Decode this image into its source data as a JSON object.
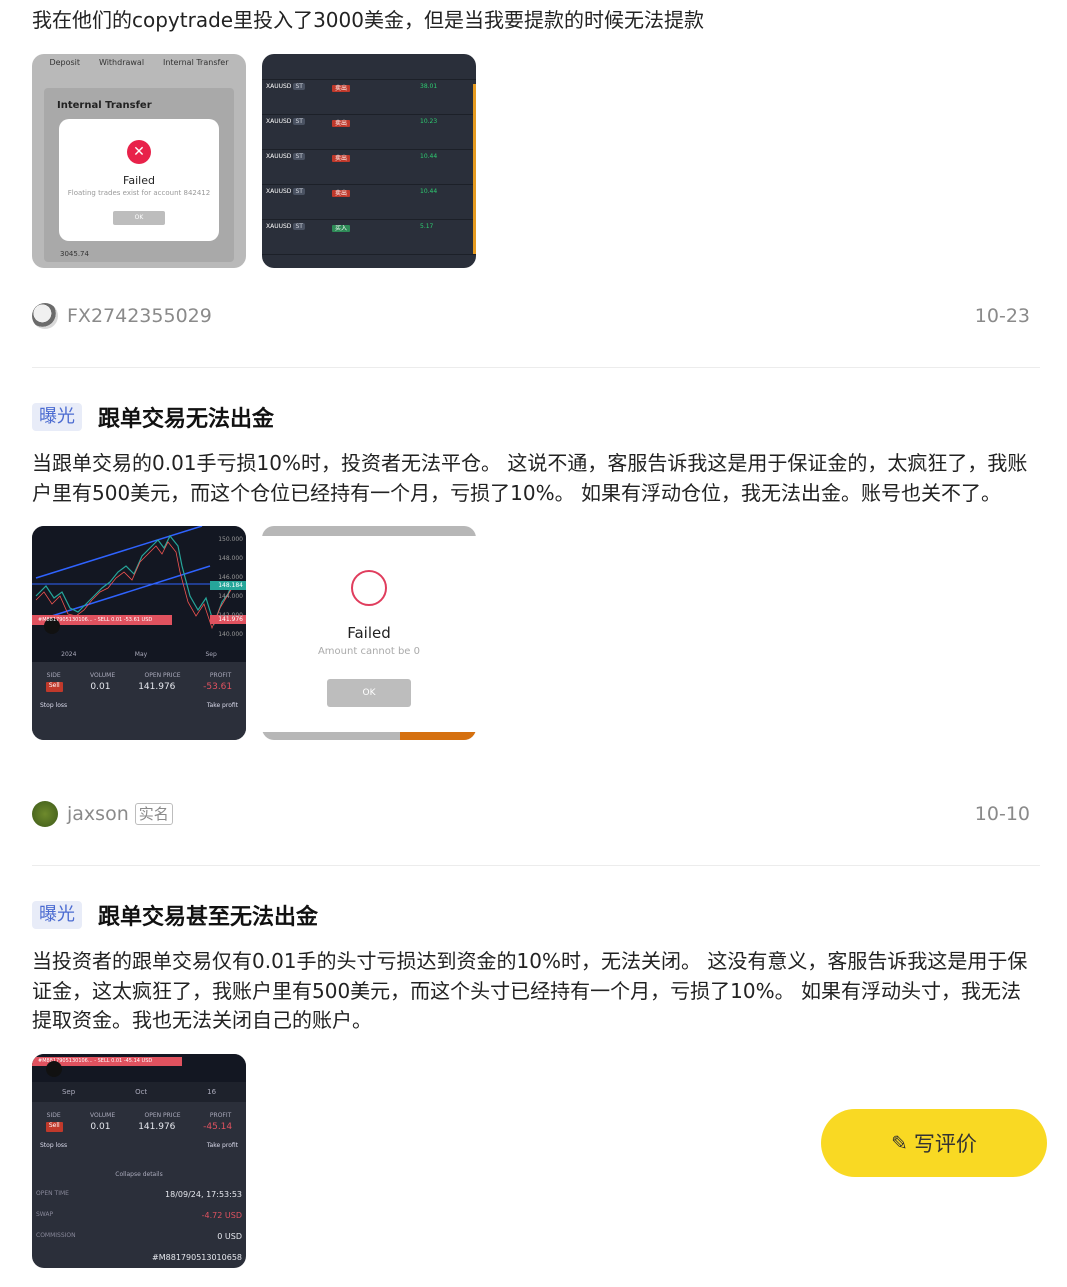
{
  "posts": [
    {
      "text": "我在他们的copytrade里投入了3000美金，但是当我要提款的时候无法提款",
      "author": "FX2742355029",
      "date": "10-23",
      "images": [
        {
          "tabs": [
            "Deposit",
            "Withdrawal",
            "Internal Transfer"
          ],
          "panel_title": "Internal Transfer",
          "amount": "3045.74",
          "dialog_title": "Failed",
          "dialog_message": "Floating trades exist for account 842412",
          "ok_label": "OK"
        },
        {
          "rows": [
            {
              "symbol": "XAUUSD",
              "badge": "ST",
              "side": "卖出",
              "value": "38.01"
            },
            {
              "symbol": "XAUUSD",
              "badge": "ST",
              "side": "卖出",
              "value": "10.23"
            },
            {
              "symbol": "XAUUSD",
              "badge": "ST",
              "side": "卖出",
              "value": "10.44"
            },
            {
              "symbol": "XAUUSD",
              "badge": "ST",
              "side": "卖出",
              "value": "10.44"
            },
            {
              "symbol": "XAUUSD",
              "badge": "ST",
              "side": "买入",
              "value": "5.17"
            }
          ]
        }
      ]
    },
    {
      "tag": "曝光",
      "title": "跟单交易无法出金",
      "text": "当跟单交易的0.01手亏损10%时，投资者无法平仓。 这说不通，客服告诉我这是用于保证金的，太疯狂了，我账户里有500美元，而这个仓位已经持有一个月，亏损了10%。 如果有浮动仓位，我无法出金。账号也关不了。",
      "author": "jaxson",
      "verified_label": "实名",
      "date": "10-10",
      "images": [
        {
          "price_labels": [
            "150.000",
            "148.000",
            "146.000",
            "144.000",
            "142.000",
            "140.000"
          ],
          "current_price": "148.184",
          "order_price": "141.976",
          "order_banner": "#M8817905130106... - SELL 0.01   -53.61 USD",
          "time_labels": [
            "2024",
            "May",
            "Sep"
          ],
          "headers": [
            "SIDE",
            "VOLUME",
            "OPEN PRICE",
            "PROFIT"
          ],
          "side": "Sell",
          "volume": "0.01",
          "open_price": "141.976",
          "profit": "-53.61",
          "stop_loss": "Stop loss",
          "take_profit": "Take profit"
        },
        {
          "dialog_title": "Failed",
          "dialog_message": "Amount cannot be 0",
          "ok_label": "OK"
        }
      ]
    },
    {
      "tag": "曝光",
      "title": "跟单交易甚至无法出金",
      "text": "当投资者的跟单交易仅有0.01手的头寸亏损达到资金的10%时，无法关闭。 这没有意义，客服告诉我这是用于保证金，这太疯狂了，我账户里有500美元，而这个头寸已经持有一个月，亏损了10%。 如果有浮动头寸，我无法提取资金。我也无法关闭自己的账户。",
      "images": [
        {
          "order_banner": "#M8817905130106... - SELL 0.01   -45.14 USD",
          "time_labels": [
            "Sep",
            "Oct",
            "16"
          ],
          "headers": [
            "SIDE",
            "VOLUME",
            "OPEN PRICE",
            "PROFIT"
          ],
          "side": "Sell",
          "volume": "0.01",
          "open_price": "141.976",
          "profit": "-45.14",
          "stop_loss": "Stop loss",
          "take_profit": "Take profit",
          "collapse": "Collapse details",
          "open_time_label": "OPEN TIME",
          "open_time": "18/09/24, 17:53:53",
          "swap_label": "SWAP",
          "swap": "-4.72 USD",
          "commission_label": "COMMISSION",
          "commission": "0 USD",
          "id": "#M881790513010658"
        }
      ]
    }
  ],
  "write_review_label": "写评价"
}
